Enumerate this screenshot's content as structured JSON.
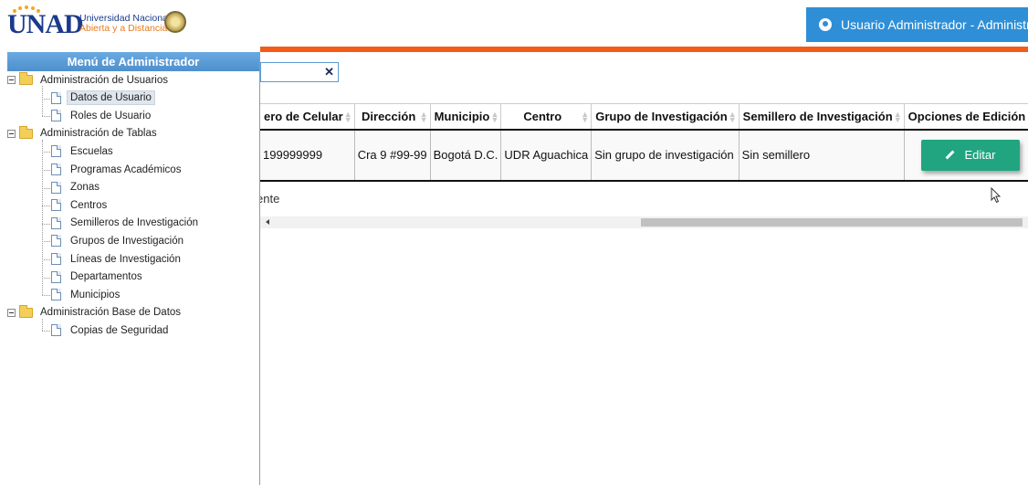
{
  "header": {
    "logo_text": "UNAD",
    "university_line1": "Universidad Nacional",
    "university_line2": "Abierta y a Distancia",
    "user_label": "Usuario Administrador - Administrador"
  },
  "sidebar": {
    "title": "Menú de Administrador",
    "groups": [
      {
        "label": "Administración de Usuarios",
        "items": [
          "Datos de Usuario",
          "Roles de Usuario"
        ]
      },
      {
        "label": "Administración de Tablas",
        "items": [
          "Escuelas",
          "Programas Académicos",
          "Zonas",
          "Centros",
          "Semilleros de Investigación",
          "Grupos de Investigación",
          "Líneas de Investigación",
          "Departamentos",
          "Municipios"
        ]
      },
      {
        "label": "Administración Base de Datos",
        "items": [
          "Copias de Seguridad"
        ]
      }
    ],
    "selected": "Datos de Usuario"
  },
  "search": {
    "value": "",
    "clear_icon": "close-icon"
  },
  "table": {
    "columns": [
      "ero de Celular",
      "Dirección",
      "Municipio",
      "Centro",
      "Grupo de Investigación",
      "Semillero de Investigación",
      "Opciones de Edición"
    ],
    "rows": [
      [
        "199999999",
        "Cra 9 #99-99",
        "Bogotá D.C.",
        "UDR Aguachica",
        "Sin grupo de investigación",
        "Sin semillero",
        "Editar"
      ]
    ]
  },
  "footer": {
    "info_text": "ente"
  },
  "colors": {
    "header_badge": "#2e8fd6",
    "accent_bar": "#f25c18",
    "menu_header": "#5b9bd5",
    "edit_button": "#20a580"
  }
}
